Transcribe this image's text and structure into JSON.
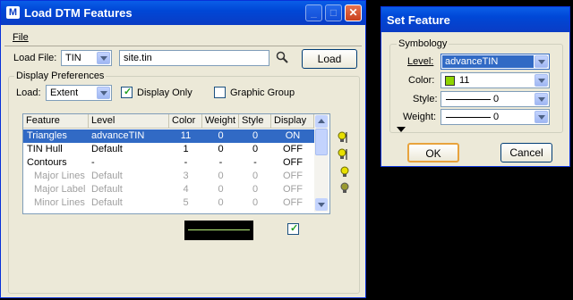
{
  "main_window": {
    "title": "Load DTM Features",
    "menu": [
      "File"
    ],
    "load_file_label": "Load File:",
    "file_type": "TIN",
    "file_name": "site.tin",
    "load_button": "Load",
    "display_prefs_label": "Display Preferences",
    "load_label": "Load:",
    "load_mode": "Extent",
    "display_only_label": "Display Only",
    "display_only_checked": true,
    "graphic_group_label": "Graphic Group",
    "graphic_group_checked": false,
    "table_headers": [
      "Feature",
      "Level",
      "Color",
      "Weight",
      "Style",
      "Display"
    ],
    "rows": [
      {
        "feature": "Triangles",
        "level": "advanceTIN",
        "color": "11",
        "weight": "0",
        "style": "0",
        "display": "ON"
      },
      {
        "feature": "TIN Hull",
        "level": "Default",
        "color": "1",
        "weight": "0",
        "style": "0",
        "display": "OFF"
      },
      {
        "feature": "Contours",
        "level": "-",
        "color": "-",
        "weight": "-",
        "style": "-",
        "display": "OFF"
      },
      {
        "feature": "Major Lines",
        "level": "Default",
        "color": "3",
        "weight": "0",
        "style": "0",
        "display": "OFF"
      },
      {
        "feature": "Major Label",
        "level": "Default",
        "color": "4",
        "weight": "0",
        "style": "0",
        "display": "OFF"
      },
      {
        "feature": "Minor Lines",
        "level": "Default",
        "color": "5",
        "weight": "0",
        "style": "0",
        "display": "OFF"
      }
    ],
    "preview_checked": true
  },
  "set_feature": {
    "title": "Set Feature",
    "symbology_label": "Symbology",
    "level_label": "Level:",
    "level_value": "advanceTIN",
    "color_label": "Color:",
    "color_value": "11",
    "color_swatch": "#8fd400",
    "style_label": "Style:",
    "style_value": "0",
    "weight_label": "Weight:",
    "weight_value": "0",
    "ok_button": "OK",
    "cancel_button": "Cancel"
  },
  "colors": {
    "titlebar": "#0a5ee8",
    "selection": "#316ac5",
    "preview_line": "#b9f07a"
  },
  "icons": [
    "app-icon",
    "minimize-icon",
    "maximize-icon",
    "close-icon",
    "search-icon",
    "bulb-icon",
    "expand-arrow-icon"
  ]
}
